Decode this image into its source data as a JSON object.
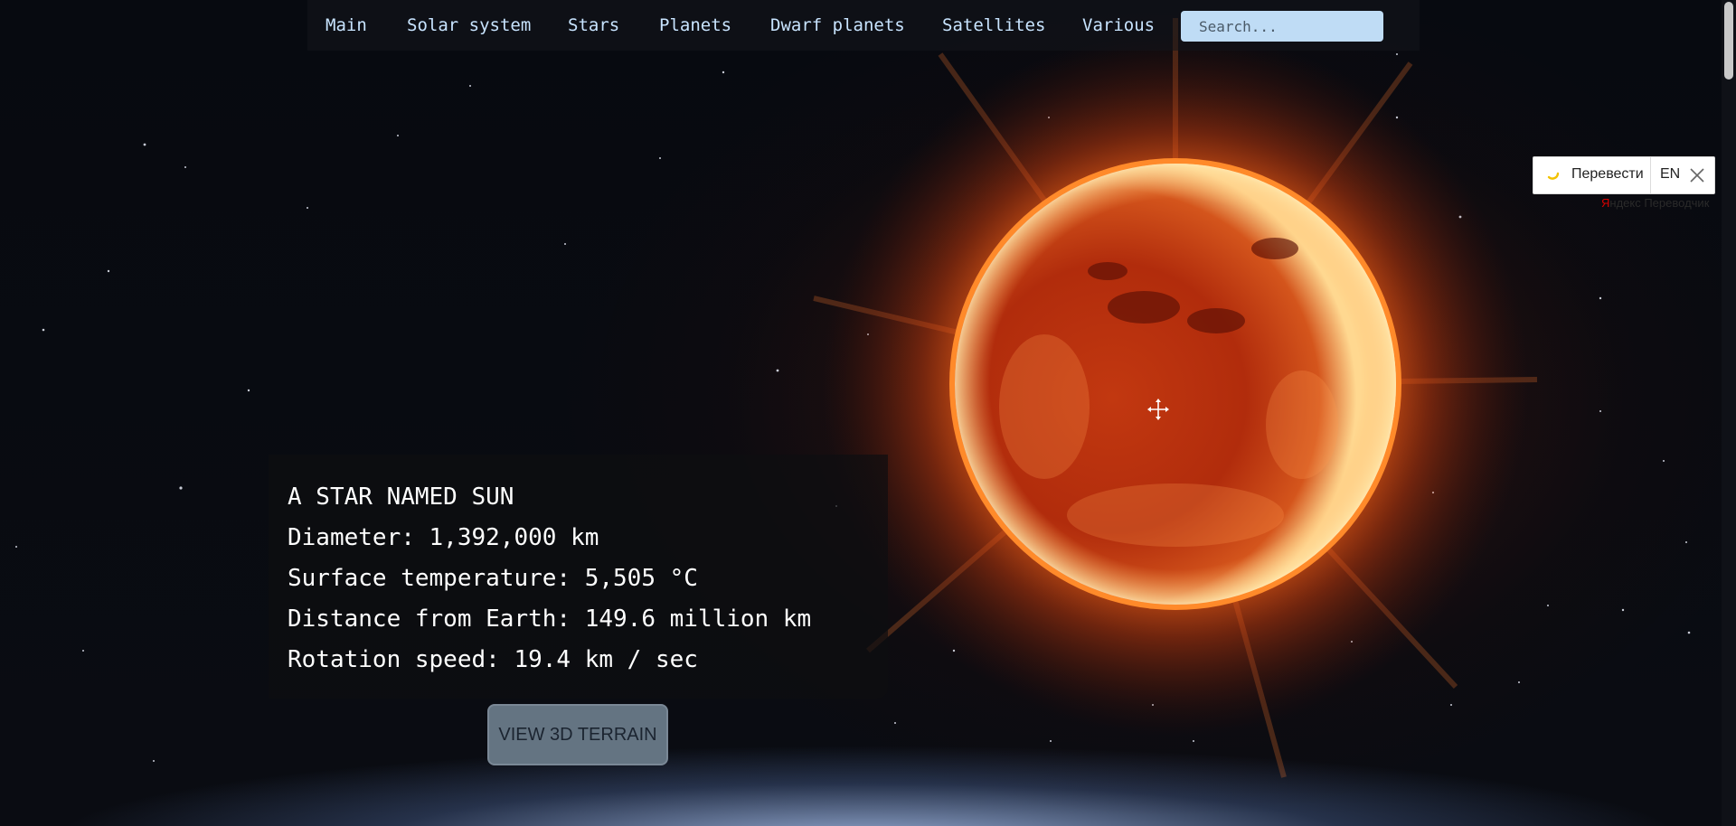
{
  "nav": {
    "items": [
      "Main",
      "Solar system",
      "Stars",
      "Planets",
      "Dwarf planets",
      "Satellites",
      "Various"
    ],
    "search_placeholder": "Search..."
  },
  "info": {
    "title": "A STAR NAMED SUN",
    "diameter": "Diameter: 1,392,000 km",
    "temperature": "Surface temperature: 5,505 °C",
    "distance": "Distance from Earth: 149.6 million km",
    "rotation": "Rotation speed: 19.4 km / sec"
  },
  "terrain_button": "VIEW 3D TERRAIN",
  "translator": {
    "label": "Перевести",
    "lang": "EN",
    "brand_mark": "Я",
    "brand_rest": "ндекс Переводчик"
  },
  "colors": {
    "nav_text": "#c8e4ff",
    "search_bg": "#bfdcf5",
    "button_bg": "#647482",
    "sun_core": "#ffe6a0",
    "sun_surface": "#c2360e"
  },
  "icons": [
    "move-cursor-icon",
    "spinner-icon",
    "close-icon"
  ]
}
